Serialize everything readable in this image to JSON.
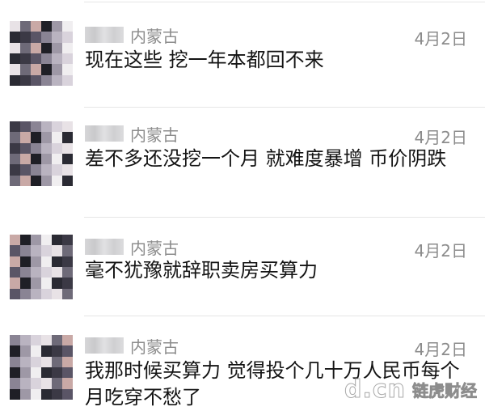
{
  "comments": [
    {
      "location": "内蒙古",
      "date": "4月2日",
      "text": "现在这些 挖一年本都回不来"
    },
    {
      "location": "内蒙古",
      "date": "4月2日",
      "text": "差不多还没挖一个月 就难度暴增 币价阴跌"
    },
    {
      "location": "内蒙古",
      "date": "4月2日",
      "text": "毫不犹豫就辞职卖房买算力"
    },
    {
      "location": "内蒙古",
      "date": "4月2日",
      "text": "我那时候买算力 觉得投个几十万人民币每个月吃穿不愁了"
    }
  ],
  "watermark": {
    "logo": "d.cn",
    "brand": "链虎财经"
  }
}
